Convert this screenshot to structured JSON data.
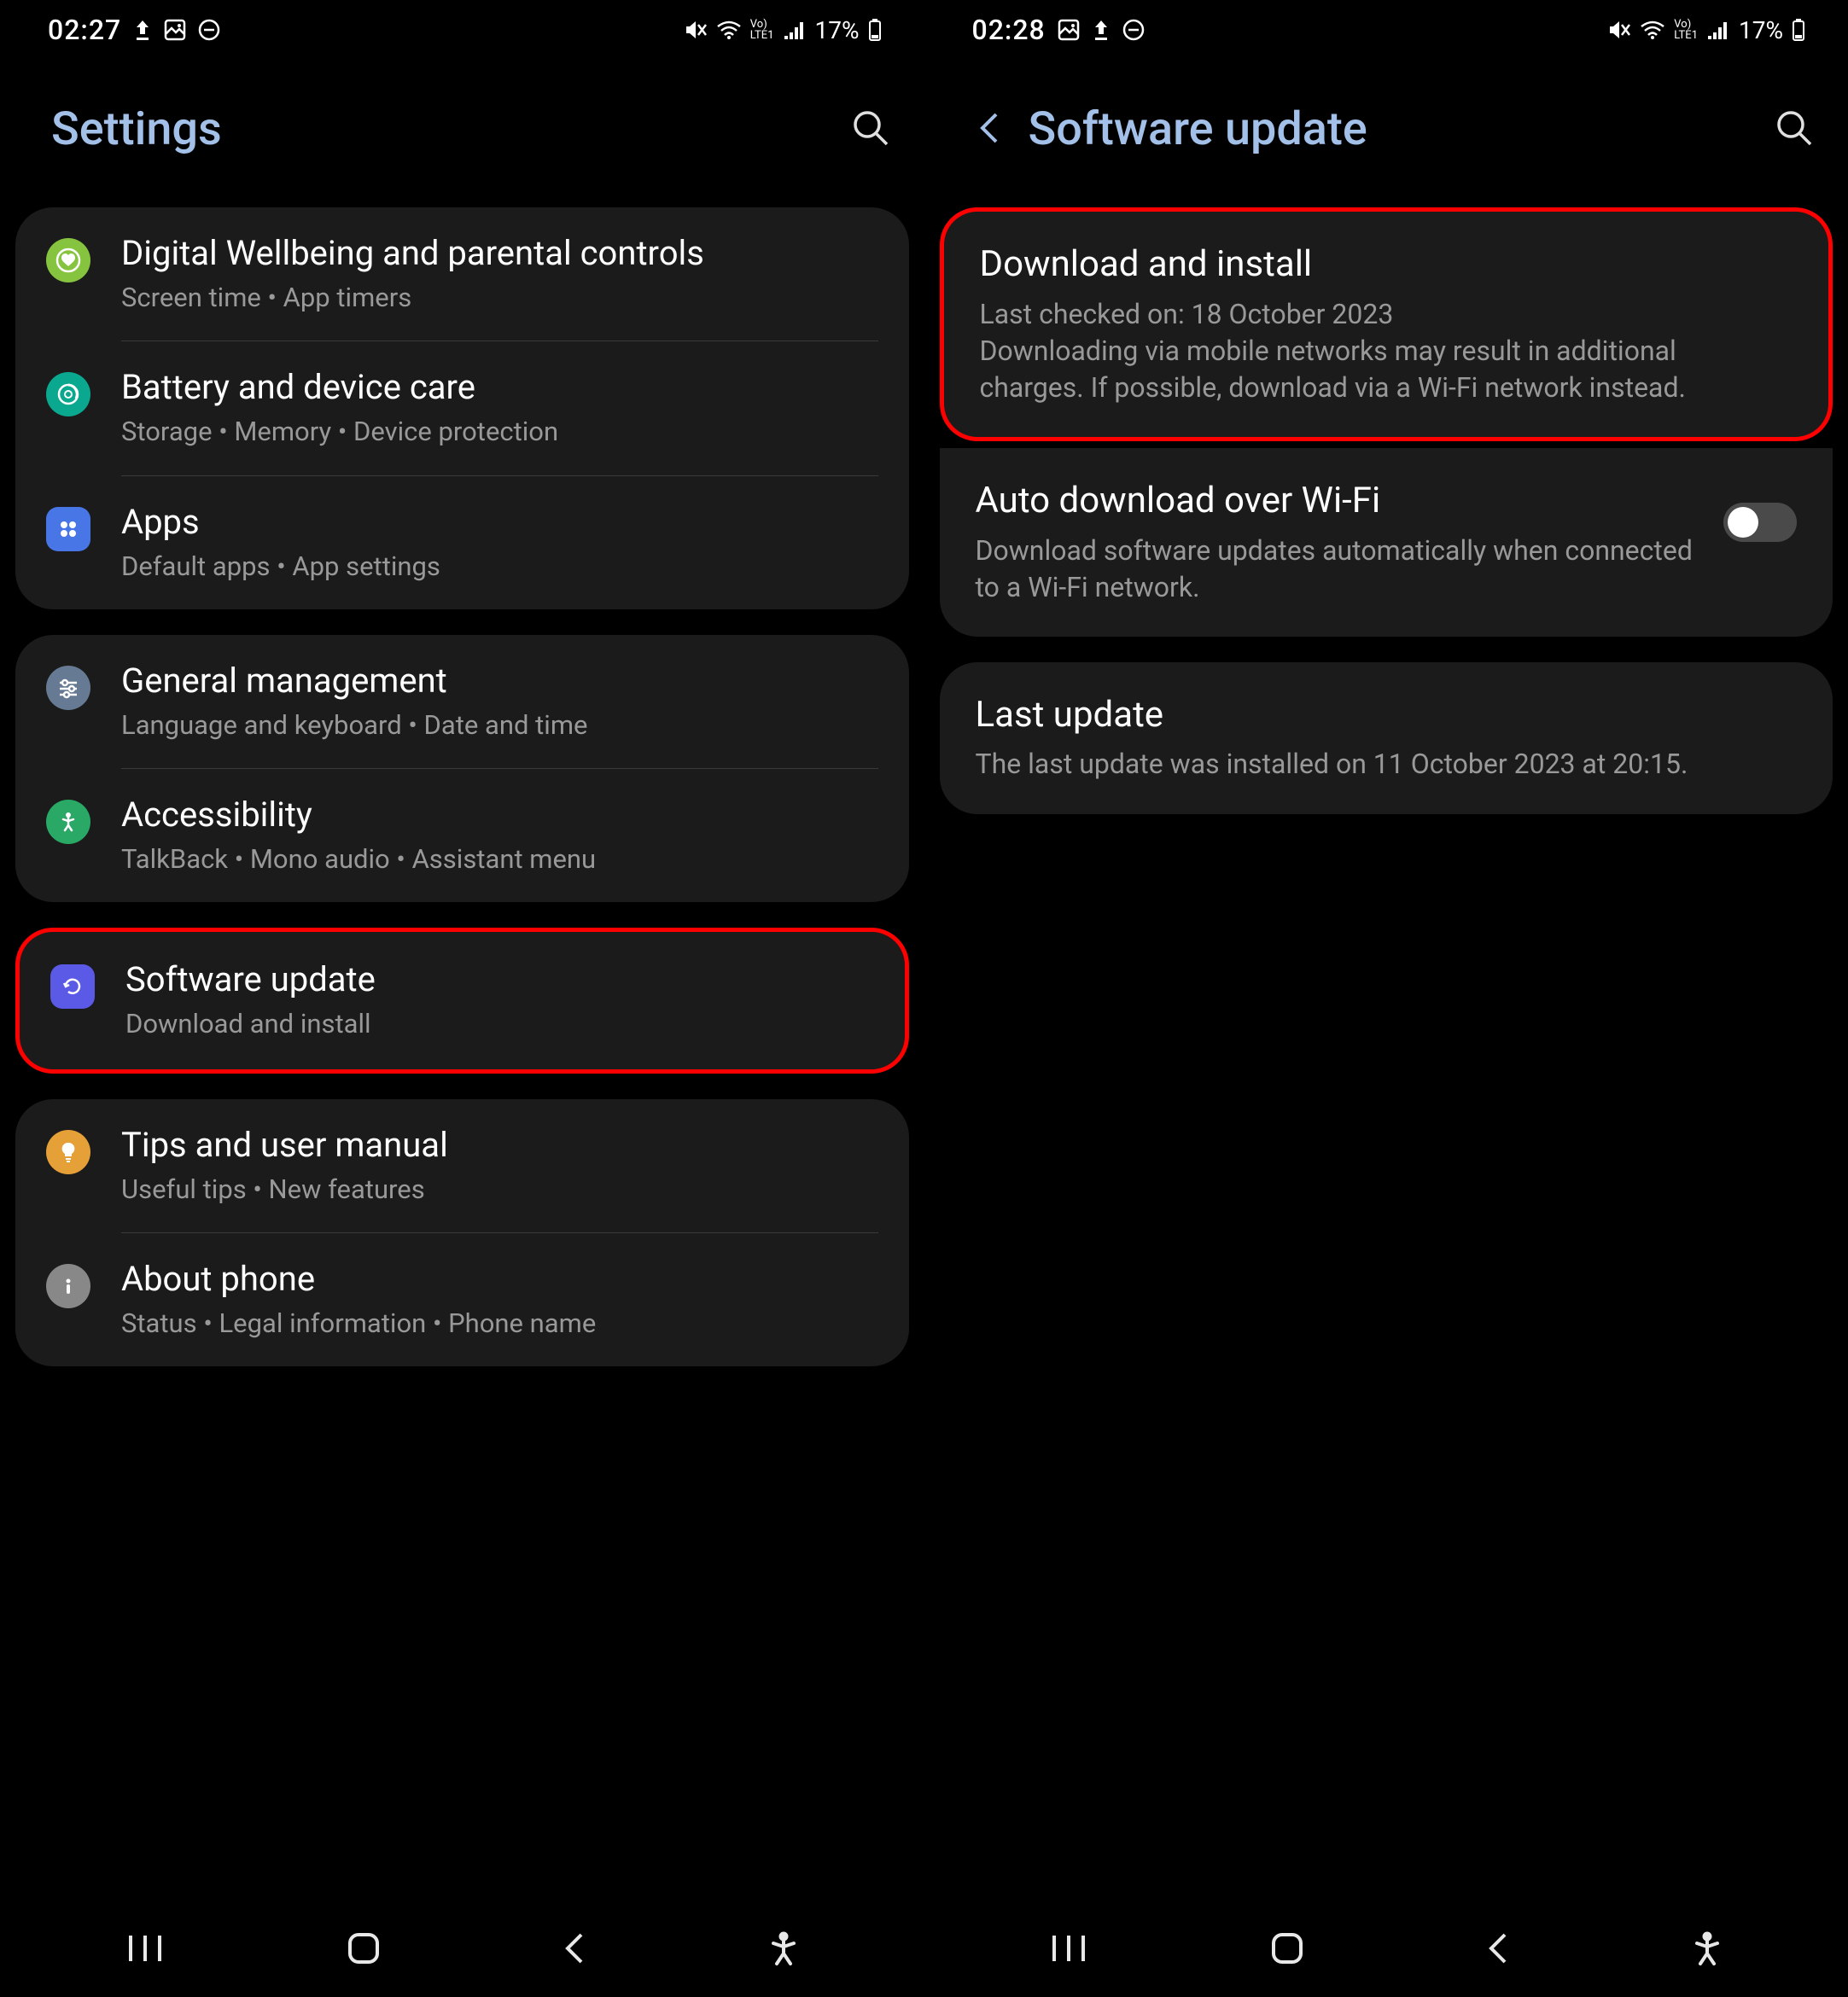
{
  "left": {
    "status": {
      "time": "02:27",
      "battery": "17%"
    },
    "title": "Settings",
    "groups": [
      {
        "items": [
          {
            "icon_color": "#86c440",
            "icon": "wellbeing",
            "title": "Digital Wellbeing and parental controls",
            "sub": "Screen time  •  App timers"
          },
          {
            "icon_color": "#0aa88f",
            "icon": "battery-care",
            "title": "Battery and device care",
            "sub": "Storage  •  Memory  •  Device protection"
          },
          {
            "icon_color": "#4876e6",
            "icon": "apps",
            "title": "Apps",
            "sub": "Default apps  •  App settings"
          }
        ]
      },
      {
        "items": [
          {
            "icon_color": "#677a93",
            "icon": "general",
            "title": "General management",
            "sub": "Language and keyboard  •  Date and time"
          },
          {
            "icon_color": "#2aa866",
            "icon": "accessibility",
            "title": "Accessibility",
            "sub": "TalkBack  •  Mono audio  •  Assistant menu"
          }
        ]
      }
    ],
    "highlighted": {
      "icon_color": "#5b5ae6",
      "icon": "update",
      "title": "Software update",
      "sub": "Download and install"
    },
    "groups2": [
      {
        "items": [
          {
            "icon_color": "#e6a038",
            "icon": "tips",
            "title": "Tips and user manual",
            "sub": "Useful tips  •  New features"
          },
          {
            "icon_color": "#888",
            "icon": "about",
            "title": "About phone",
            "sub": "Status  •  Legal information  •  Phone name"
          }
        ]
      }
    ]
  },
  "right": {
    "status": {
      "time": "02:28",
      "battery": "17%"
    },
    "title": "Software update",
    "highlighted": {
      "title": "Download and install",
      "sub": "Last checked on: 18 October 2023\nDownloading via mobile networks may result in additional charges. If possible, download via a Wi-Fi network instead."
    },
    "auto": {
      "title": "Auto download over Wi-Fi",
      "sub": "Download software updates automatically when connected to a Wi-Fi network.",
      "toggle": false
    },
    "last": {
      "title": "Last update",
      "sub": "The last update was installed on 11 October 2023 at 20:15."
    }
  }
}
